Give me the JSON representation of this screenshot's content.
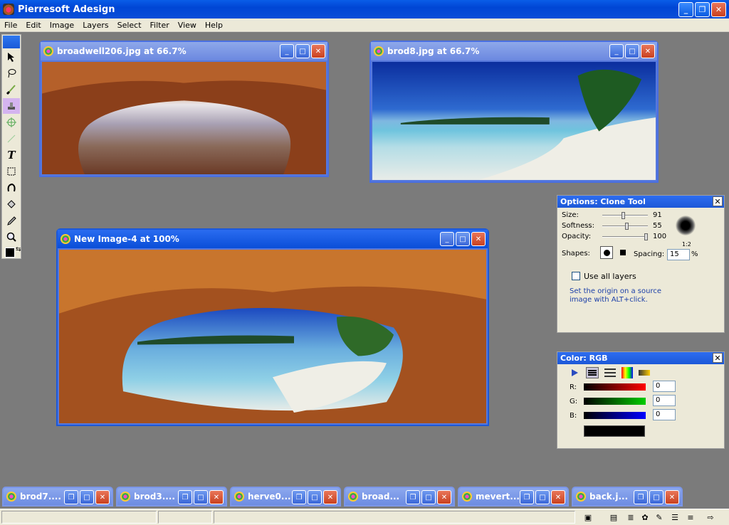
{
  "app": {
    "title": "Pierresoft Adesign"
  },
  "menu": [
    "File",
    "Edit",
    "Image",
    "Layers",
    "Select",
    "Filter",
    "View",
    "Help"
  ],
  "tools": [
    "select-arrow-icon",
    "lasso-icon",
    "brush-icon",
    "clone-stamp-icon",
    "transform-icon",
    "line-icon",
    "text-icon",
    "crop-icon",
    "gradient-icon",
    "fill-bucket-icon",
    "eyedropper-icon",
    "zoom-icon"
  ],
  "documents": [
    {
      "title": "broadwell206.jpg at 66.7%"
    },
    {
      "title": "brod8.jpg at 66.7%"
    },
    {
      "title": "New Image-4 at 100%"
    }
  ],
  "options_panel": {
    "title": "Options: Clone Tool",
    "size_label": "Size:",
    "size_value": "91",
    "size_fraction": 0.46,
    "softness_label": "Softness:",
    "softness_value": "55",
    "softness_fraction": 0.55,
    "opacity_label": "Opacity:",
    "opacity_value": "100",
    "opacity_fraction": 1.0,
    "brush_ratio": "1:2",
    "shapes_label": "Shapes:",
    "spacing_label": "Spacing:",
    "spacing_value": "15",
    "spacing_unit": "%",
    "use_all_layers": "Use all layers",
    "hint": "Set the origin on a source image with ALT+click."
  },
  "color_panel": {
    "title": "Color: RGB",
    "r_label": "R:",
    "r_value": "0",
    "g_label": "G:",
    "g_value": "0",
    "b_label": "B:",
    "b_value": "0",
    "current_color": "#000000"
  },
  "minimized": [
    {
      "title": "brod7...."
    },
    {
      "title": "brod3...."
    },
    {
      "title": "herve0..."
    },
    {
      "title": "broad..."
    },
    {
      "title": "mevert..."
    },
    {
      "title": "back.j..."
    }
  ]
}
